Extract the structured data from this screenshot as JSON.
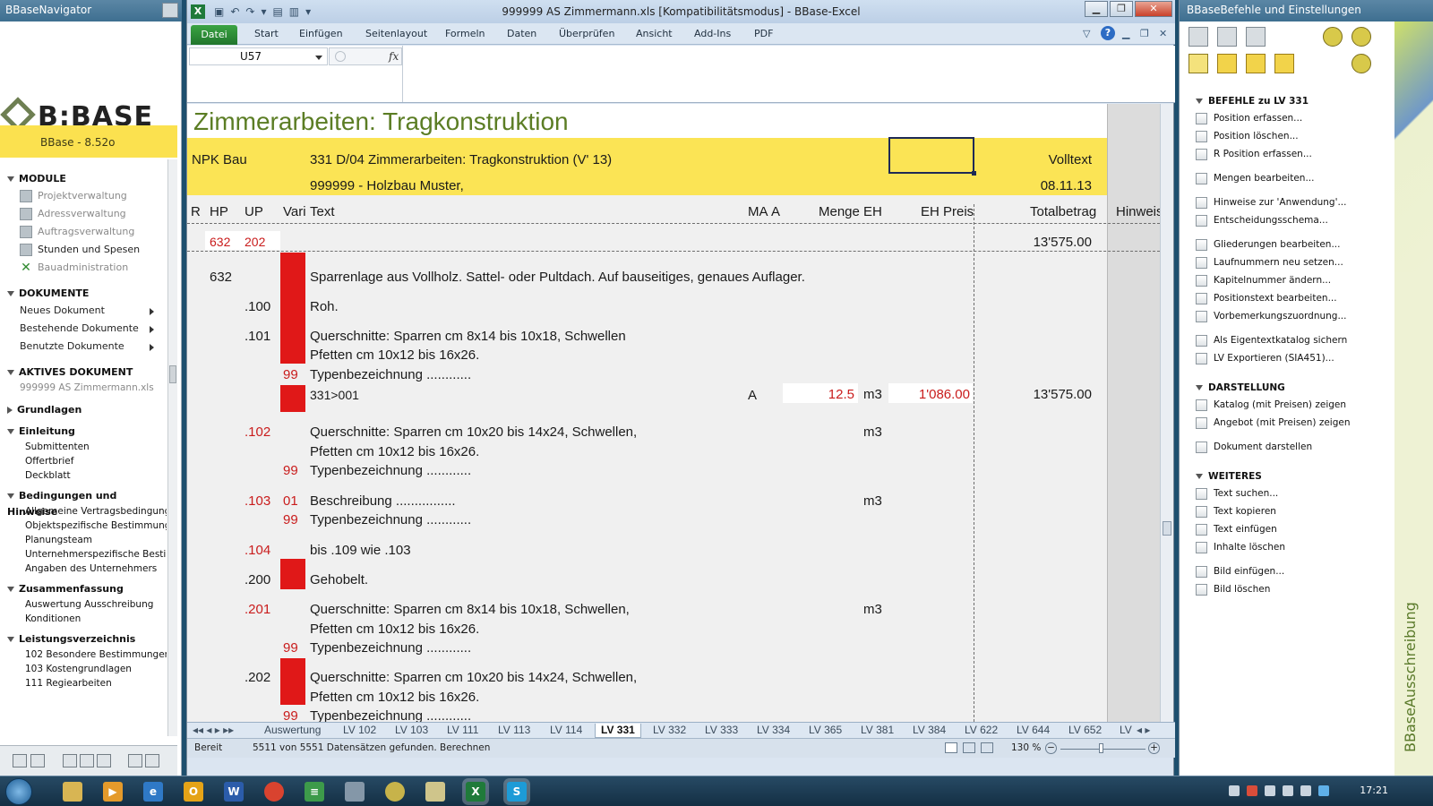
{
  "navigator": {
    "title": "BBaseNavigator",
    "logo": "B:BASE",
    "version": "BBase - 8.52o",
    "sections": {
      "module": {
        "label": "MODULE",
        "items": [
          "Projektverwaltung",
          "Adressverwaltung",
          "Auftragsverwaltung",
          "Stunden und Spesen",
          "Bauadministration"
        ]
      },
      "dokumente": {
        "label": "DOKUMENTE",
        "items": [
          "Neues Dokument",
          "Bestehende Dokumente",
          "Benutzte Dokumente"
        ]
      },
      "aktives": {
        "label": "AKTIVES DOKUMENT",
        "file": "999999 AS Zimmermann.xls"
      },
      "grundlagen": "Grundlagen",
      "einleitung": {
        "label": "Einleitung",
        "items": [
          "Submittenten",
          "Offertbrief",
          "Deckblatt"
        ]
      },
      "bedingungen": {
        "label": "Bedingungen und Hinweise",
        "items": [
          "Allgemeine Vertragsbedingung",
          "Objektspezifische Bestimmung",
          "Planungsteam",
          "Unternehmerspezifische Bestin",
          "Angaben des Unternehmers"
        ]
      },
      "zusammenfassung": {
        "label": "Zusammenfassung",
        "items": [
          "Auswertung Ausschreibung",
          "Konditionen"
        ]
      },
      "leistungsverzeichnis": {
        "label": "Leistungsverzeichnis",
        "items": [
          "102  Besondere Bestimmunger",
          "103  Kostengrundlagen",
          "111  Regiearbeiten"
        ]
      }
    }
  },
  "excel": {
    "window_title": "999999 AS Zimmermann.xls  [Kompatibilitätsmodus]  -  BBase-Excel",
    "ribbon_tabs": [
      "Datei",
      "Start",
      "Einfügen",
      "Seitenlayout",
      "Formeln",
      "Daten",
      "Überprüfen",
      "Ansicht",
      "Add-Ins",
      "PDF"
    ],
    "name_box": "U57",
    "fx": "fx",
    "sheet": {
      "title": "Zimmerarbeiten: Tragkonstruktion",
      "npk": "NPK Bau",
      "catalog": "331 D/04 Zimmerarbeiten: Tragkonstruktion (V' 13)",
      "company": "999999 - Holzbau Muster,",
      "mode": "Volltext",
      "date": "08.11.13",
      "headers": {
        "r": "R",
        "hp": "HP",
        "up": "UP",
        "vari": "Vari",
        "text": "Text",
        "ma": "MA",
        "a": "A",
        "menge": "Menge",
        "eh": "EH",
        "ehpreis": "EH Preis",
        "total": "Totalbetrag",
        "hinweis": "Hinweis"
      },
      "summary": {
        "hp": "632",
        "up": "202",
        "total": "13'575.00"
      },
      "rows": {
        "r632": {
          "hp": "632",
          "text": "Sparrenlage aus Vollholz. Sattel- oder Pultdach. Auf bauseitiges, genaues Auflager."
        },
        "r100": {
          "up": ".100",
          "text": "Roh."
        },
        "r101": {
          "up": ".101",
          "text1": "Querschnitte: Sparren cm 8x14 bis 10x18, Schwellen",
          "text2": "Pfetten cm 10x12 bis 16x26.",
          "vari": "99",
          "typ": "Typenbezeichnung ............"
        },
        "r331": {
          "text": "331>001",
          "a": "A",
          "menge": "12.5",
          "eh": "m3",
          "preis": "1'086.00",
          "total": "13'575.00"
        },
        "r102": {
          "up": ".102",
          "text1": "Querschnitte: Sparren cm 10x20 bis 14x24, Schwellen,",
          "text2": "Pfetten cm 10x12 bis 16x26.",
          "eh": "m3",
          "vari": "99",
          "typ": "Typenbezeichnung ............"
        },
        "r103": {
          "up": ".103",
          "vari1": "01",
          "text": "Beschreibung ................",
          "eh": "m3",
          "vari2": "99",
          "typ": "Typenbezeichnung ............"
        },
        "r104": {
          "up": ".104",
          "text": "bis .109 wie .103"
        },
        "r200": {
          "up": ".200",
          "text": "Gehobelt."
        },
        "r201": {
          "up": ".201",
          "text1": "Querschnitte: Sparren cm 8x14 bis 10x18, Schwellen,",
          "text2": "Pfetten cm 10x12 bis 16x26.",
          "eh": "m3",
          "vari": "99",
          "typ": "Typenbezeichnung ............"
        },
        "r202": {
          "up": ".202",
          "text1": "Querschnitte: Sparren cm 10x20 bis 14x24, Schwellen,",
          "text2": "Pfetten cm 10x12 bis 16x26.",
          "vari": "99",
          "typ": "Typenbezeichnung ............"
        }
      }
    },
    "sheet_tabs": [
      "Auswertung",
      "LV 102",
      "LV 103",
      "LV 111",
      "LV 113",
      "LV 114",
      "LV 331",
      "LV 332",
      "LV 333",
      "LV 334",
      "LV 365",
      "LV 381",
      "LV 384",
      "LV 622",
      "LV 644",
      "LV 652",
      "LV"
    ],
    "active_tab": "LV 331",
    "status": {
      "ready": "Bereit",
      "records": "5511 von 5551 Datensätzen gefunden.",
      "calc": "Berechnen",
      "zoom": "130 %"
    }
  },
  "commands": {
    "title": "BBaseBefehle und Einstellungen",
    "befehle": {
      "label": "BEFEHLE zu LV 331",
      "items": [
        "Position erfassen...",
        "Position löschen...",
        "R Position erfassen...",
        "Mengen bearbeiten...",
        "Hinweise zur 'Anwendung'...",
        "Entscheidungsschema...",
        "Gliederungen bearbeiten...",
        "Laufnummern neu setzen...",
        "Kapitelnummer ändern...",
        "Positionstext bearbeiten...",
        "Vorbemerkungszuordnung...",
        "Als Eigentextkatalog sichern",
        "LV Exportieren (SIA451)..."
      ]
    },
    "darstellung": {
      "label": "DARSTELLUNG",
      "items": [
        "Katalog (mit Preisen) zeigen",
        "Angebot (mit Preisen) zeigen",
        "Dokument darstellen"
      ]
    },
    "weiteres": {
      "label": "WEITERES",
      "items": [
        "Text suchen...",
        "Text kopieren",
        "Text einfügen",
        "Inhalte löschen",
        "Bild einfügen...",
        "Bild löschen"
      ]
    },
    "side_label": "BBaseAusschreibung"
  },
  "taskbar": {
    "clock": "17:21"
  },
  "colors": {
    "accent_yellow": "#fbe455",
    "title_green": "#5b7d24",
    "red": "#e01818",
    "excel_green": "#21762d"
  }
}
